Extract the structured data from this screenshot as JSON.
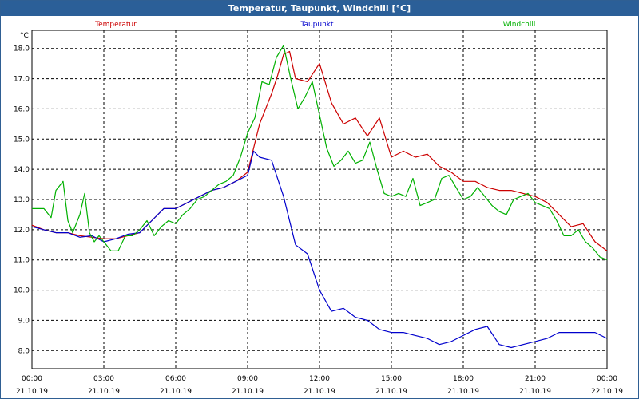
{
  "window": {
    "title": "Temperatur, Taupunkt, Windchill [°C]"
  },
  "colors": {
    "temperatur": "#cc0000",
    "taupunkt": "#0000cc",
    "windchill": "#00b000",
    "grid": "#000000"
  },
  "chart_data": {
    "type": "line",
    "title": "Temperatur, Taupunkt, Windchill [°C]",
    "ylabel": "°C",
    "xlabel": "",
    "ylim": [
      7.4,
      18.6
    ],
    "xlim": [
      0,
      24
    ],
    "grid": true,
    "y_ticks": [
      "8.0",
      "9.0",
      "10.0",
      "11.0",
      "12.0",
      "13.0",
      "14.0",
      "15.0",
      "16.0",
      "17.0",
      "18.0"
    ],
    "x_tick_times": [
      "00:00",
      "03:00",
      "06:00",
      "09:00",
      "12:00",
      "15:00",
      "18:00",
      "21:00",
      "00:00"
    ],
    "x_tick_dates": [
      "21.10.19",
      "21.10.19",
      "21.10.19",
      "21.10.19",
      "21.10.19",
      "21.10.19",
      "21.10.19",
      "21.10.19",
      "22.10.19"
    ],
    "series": [
      {
        "name": "Temperatur",
        "color": "#cc0000",
        "x": [
          0,
          0.5,
          1,
          1.5,
          2,
          2.5,
          3,
          3.5,
          4,
          4.5,
          5,
          5.5,
          6,
          6.5,
          7,
          7.5,
          8,
          8.5,
          9,
          9.5,
          10,
          10.25,
          10.5,
          10.75,
          11,
          11.5,
          12,
          12.5,
          13,
          13.5,
          14,
          14.5,
          15,
          15.5,
          16,
          16.5,
          17,
          17.5,
          18,
          18.5,
          19,
          19.5,
          20,
          20.5,
          21,
          21.5,
          22,
          22.5,
          23,
          23.5,
          24
        ],
        "y": [
          12.15,
          12.0,
          11.9,
          11.9,
          11.8,
          11.75,
          11.7,
          11.7,
          11.8,
          11.9,
          12.3,
          12.7,
          12.7,
          12.9,
          13.1,
          13.3,
          13.4,
          13.6,
          13.9,
          15.5,
          16.5,
          17.1,
          17.8,
          17.9,
          17.0,
          16.9,
          17.5,
          16.2,
          15.5,
          15.7,
          15.1,
          15.7,
          14.4,
          14.6,
          14.4,
          14.5,
          14.1,
          13.9,
          13.6,
          13.6,
          13.4,
          13.3,
          13.3,
          13.2,
          13.1,
          12.9,
          12.5,
          12.1,
          12.2,
          11.6,
          11.3
        ]
      },
      {
        "name": "Taupunkt",
        "color": "#0000cc",
        "x": [
          0,
          0.5,
          1,
          1.5,
          2,
          2.5,
          3,
          3.5,
          4,
          4.5,
          5,
          5.5,
          6,
          6.5,
          7,
          7.5,
          8,
          8.5,
          9,
          9.25,
          9.5,
          10,
          10.5,
          11,
          11.5,
          12,
          12.5,
          13,
          13.5,
          14,
          14.5,
          15,
          15.5,
          16,
          16.5,
          17,
          17.5,
          18,
          18.5,
          19,
          19.5,
          20,
          20.5,
          21,
          21.5,
          22,
          22.5,
          23,
          23.5,
          24
        ],
        "y": [
          12.1,
          12.0,
          11.9,
          11.9,
          11.75,
          11.8,
          11.6,
          11.7,
          11.85,
          11.9,
          12.3,
          12.7,
          12.7,
          12.9,
          13.1,
          13.3,
          13.4,
          13.6,
          13.8,
          14.6,
          14.4,
          14.3,
          13.1,
          11.5,
          11.2,
          10.0,
          9.3,
          9.4,
          9.1,
          9.0,
          8.7,
          8.6,
          8.6,
          8.5,
          8.4,
          8.2,
          8.3,
          8.5,
          8.7,
          8.8,
          8.2,
          8.1,
          8.2,
          8.3,
          8.4,
          8.6,
          8.6,
          8.6,
          8.6,
          8.4
        ]
      },
      {
        "name": "Windchill",
        "color": "#00b000",
        "x": [
          0,
          0.5,
          0.8,
          1,
          1.3,
          1.5,
          1.7,
          2,
          2.2,
          2.4,
          2.6,
          2.8,
          3,
          3.3,
          3.6,
          3.9,
          4.2,
          4.5,
          4.8,
          5.1,
          5.4,
          5.7,
          6,
          6.3,
          6.6,
          6.9,
          7.2,
          7.5,
          7.8,
          8.1,
          8.4,
          8.7,
          9,
          9.3,
          9.6,
          9.9,
          10.2,
          10.5,
          10.8,
          11.1,
          11.4,
          11.7,
          12,
          12.3,
          12.6,
          12.9,
          13.2,
          13.5,
          13.8,
          14.1,
          14.4,
          14.7,
          15,
          15.3,
          15.6,
          15.9,
          16.2,
          16.5,
          16.8,
          17.1,
          17.4,
          17.7,
          18,
          18.3,
          18.6,
          18.9,
          19.2,
          19.5,
          19.8,
          20.1,
          20.4,
          20.7,
          21,
          21.3,
          21.6,
          21.9,
          22.2,
          22.5,
          22.8,
          23.1,
          23.4,
          23.7,
          24
        ],
        "y": [
          12.7,
          12.7,
          12.4,
          13.3,
          13.6,
          12.3,
          11.9,
          12.5,
          13.2,
          11.9,
          11.6,
          11.8,
          11.6,
          11.3,
          11.3,
          11.8,
          11.8,
          12.0,
          12.3,
          11.8,
          12.1,
          12.3,
          12.2,
          12.5,
          12.7,
          13.0,
          13.1,
          13.3,
          13.5,
          13.6,
          13.8,
          14.4,
          15.2,
          15.7,
          16.9,
          16.8,
          17.7,
          18.1,
          17.0,
          16.0,
          16.4,
          16.9,
          15.8,
          14.7,
          14.1,
          14.3,
          14.6,
          14.2,
          14.3,
          14.9,
          14.0,
          13.2,
          13.1,
          13.2,
          13.1,
          13.7,
          12.8,
          12.9,
          13.0,
          13.7,
          13.8,
          13.4,
          13.0,
          13.1,
          13.4,
          13.1,
          12.8,
          12.6,
          12.5,
          13.0,
          13.1,
          13.2,
          12.9,
          12.8,
          12.7,
          12.3,
          11.8,
          11.8,
          12.0,
          11.6,
          11.4,
          11.1,
          11.0
        ]
      }
    ]
  }
}
